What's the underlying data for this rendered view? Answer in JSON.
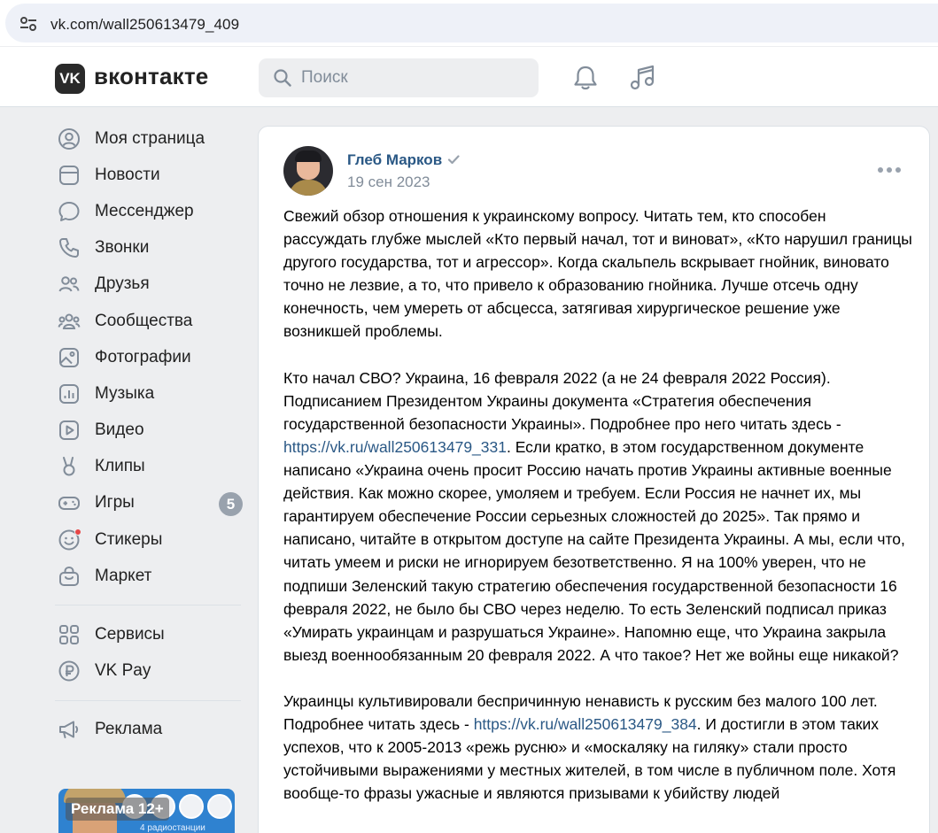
{
  "browser": {
    "url": "vk.com/wall250613479_409"
  },
  "header": {
    "logo_text": "VK",
    "brand": "вконтакте",
    "search_placeholder": "Поиск",
    "icons": [
      "bell-icon",
      "music-icon"
    ]
  },
  "sidebar": {
    "items": [
      {
        "label": "Моя страница",
        "icon": "user-circle-icon"
      },
      {
        "label": "Новости",
        "icon": "newsfeed-icon"
      },
      {
        "label": "Мессенджер",
        "icon": "message-icon"
      },
      {
        "label": "Звонки",
        "icon": "phone-icon"
      },
      {
        "label": "Друзья",
        "icon": "friends-icon"
      },
      {
        "label": "Сообщества",
        "icon": "communities-icon"
      },
      {
        "label": "Фотографии",
        "icon": "photo-icon"
      },
      {
        "label": "Музыка",
        "icon": "music-chart-icon"
      },
      {
        "label": "Видео",
        "icon": "video-icon"
      },
      {
        "label": "Клипы",
        "icon": "clips-icon"
      },
      {
        "label": "Игры",
        "icon": "gamepad-icon",
        "badge": "5"
      },
      {
        "label": "Стикеры",
        "icon": "sticker-icon"
      },
      {
        "label": "Маркет",
        "icon": "market-bag-icon"
      }
    ],
    "items2": [
      {
        "label": "Сервисы",
        "icon": "services-grid-icon"
      },
      {
        "label": "VK Pay",
        "icon": "vkpay-icon"
      }
    ],
    "items3": [
      {
        "label": "Реклама",
        "icon": "megaphone-icon"
      }
    ],
    "ad": {
      "label": "Реклама 12+",
      "small": "4 радиостанции"
    }
  },
  "post": {
    "author": "Глеб Марков",
    "date": "19 сен 2023",
    "paragraphs": [
      {
        "parts": [
          {
            "text": "Свежий обзор отношения к украинскому вопросу. Читать тем, кто способен рассуждать глубже мыслей «Кто первый начал, тот и виноват», «Кто нарушил границы другого государства, тот и агрессор». Когда скальпель вскрывает гнойник, виновато точно не лезвие, а то, что привело к образованию гнойника. Лучше отсечь одну конечность, чем умереть от абсцесса, затягивая хирургическое решение уже возникшей проблемы."
          }
        ]
      },
      {
        "parts": [
          {
            "text": "Кто начал СВО? Украина, 16 февраля 2022 (а не 24 февраля 2022 Россия). Подписанием Президентом Украины документа «Стратегия обеспечения государственной безопасности Украины». Подробнее про него читать здесь - "
          },
          {
            "link": "https://vk.ru/wall250613479_331"
          },
          {
            "text": ". Если кратко, в этом государственном документе написано «Украина очень просит Россию начать против Украины активные военные действия. Как можно скорее, умоляем и требуем. Если Россия не начнет их, мы гарантируем обеспечение России серьезных сложностей до 2025». Так прямо и написано, читайте в открытом доступе на сайте Президента Украины. А мы, если что, читать умеем и риски не игнорируем безответственно. Я на 100% уверен, что не подпиши Зеленский такую стратегию обеспечения государственной безопасности 16 февраля 2022, не было бы СВО через неделю. То есть Зеленский подписал приказ «Умирать украинцам и разрушаться Украине». Напомню еще, что Украина закрыла выезд военнообязанным 20 февраля 2022. А что такое? Нет же войны еще никакой?"
          }
        ]
      },
      {
        "parts": [
          {
            "text": "Украинцы культивировали беспричинную ненависть к русским без малого 100 лет. Подробнее читать здесь - "
          },
          {
            "link": "https://vk.ru/wall250613479_384"
          },
          {
            "text": ". И достигли в этом таких успехов, что к 2005-2013 «режь русню» и «москаляку на гиляку» стали просто устойчивыми выражениями у местных жителей, в том числе в публичном поле. Хотя вообще-то фразы ужасные и являются призывами к убийству людей"
          }
        ]
      }
    ]
  }
}
